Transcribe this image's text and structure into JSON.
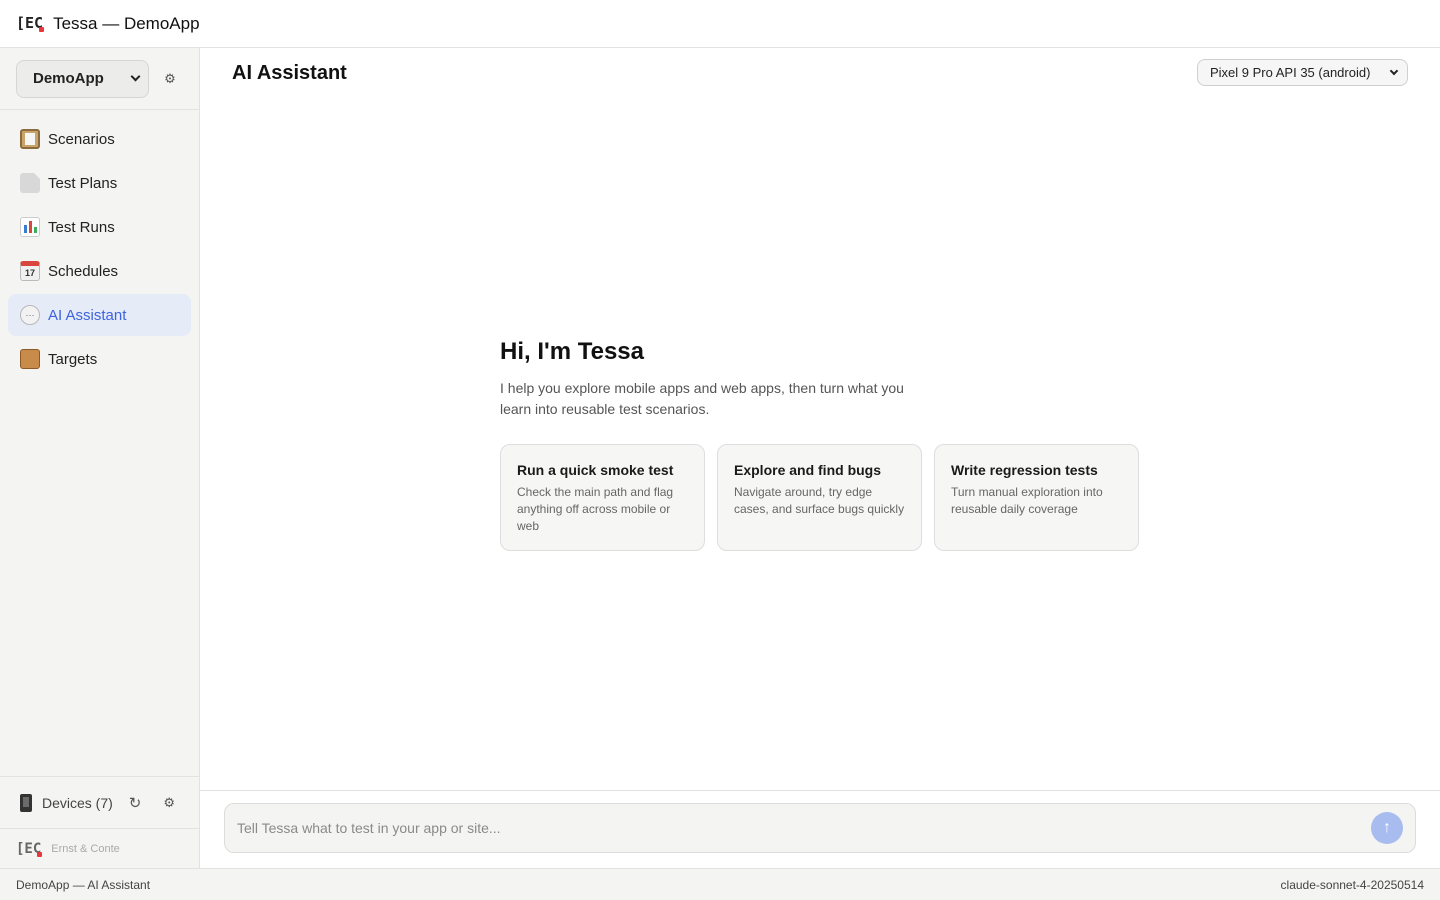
{
  "titlebar": {
    "logo_text": "[EC",
    "title": "Tessa — DemoApp"
  },
  "sidebar": {
    "project": {
      "selected": "DemoApp"
    },
    "items": [
      {
        "label": "Scenarios",
        "icon": "clipboard-icon",
        "active": false
      },
      {
        "label": "Test Plans",
        "icon": "document-icon",
        "active": false
      },
      {
        "label": "Test Runs",
        "icon": "bar-chart-icon",
        "active": false
      },
      {
        "label": "Schedules",
        "icon": "calendar-icon",
        "active": false,
        "icon_text": "17"
      },
      {
        "label": "AI Assistant",
        "icon": "speech-bubble-icon",
        "active": true,
        "icon_text": "···"
      },
      {
        "label": "Targets",
        "icon": "package-icon",
        "active": false
      }
    ],
    "devices": {
      "label": "Devices (7)"
    },
    "brand": {
      "logo_text": "[EC",
      "name": "Ernst & Conte"
    }
  },
  "main": {
    "title": "AI Assistant",
    "device_select": {
      "selected": "Pixel 9 Pro API 35 (android)"
    },
    "welcome": {
      "heading": "Hi, I'm Tessa",
      "description": "I help you explore mobile apps and web apps, then turn what you learn into reusable test scenarios.",
      "cards": [
        {
          "title": "Run a quick smoke test",
          "description": "Check the main path and flag anything off across mobile or web"
        },
        {
          "title": "Explore and find bugs",
          "description": "Navigate around, try edge cases, and surface bugs quickly"
        },
        {
          "title": "Write regression tests",
          "description": "Turn manual exploration into reusable daily coverage"
        }
      ]
    },
    "composer": {
      "placeholder": "Tell Tessa what to test in your app or site...",
      "value": ""
    }
  },
  "statusbar": {
    "left": "DemoApp — AI Assistant",
    "right": "claude-sonnet-4-20250514"
  },
  "colors": {
    "accent": "#3d63dd",
    "active_bg": "#e6ebf8",
    "send_button": "#a9bcef",
    "logo_dot": "#e8383d"
  }
}
